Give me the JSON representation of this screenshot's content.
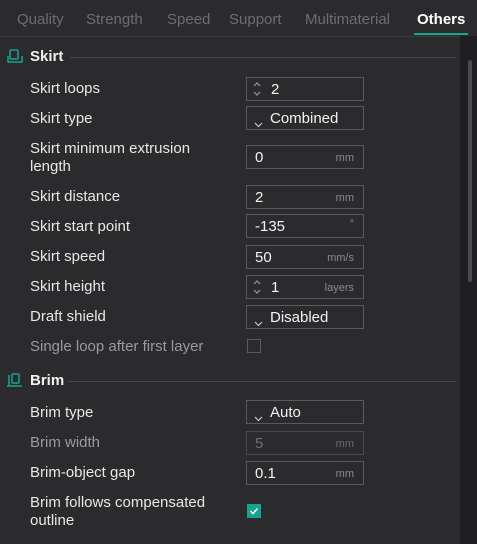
{
  "tabs": [
    {
      "label": "Quality"
    },
    {
      "label": "Strength"
    },
    {
      "label": "Speed"
    },
    {
      "label": "Support"
    },
    {
      "label": "Multimaterial"
    },
    {
      "label": "Others"
    }
  ],
  "active_tab": "Others",
  "accent_color": "#17a38d",
  "sections": {
    "skirt": {
      "title": "Skirt",
      "icon": "skirt-icon",
      "rows": {
        "loops": {
          "label": "Skirt loops",
          "value": "2"
        },
        "type": {
          "label": "Skirt type",
          "value": "Combined"
        },
        "min_extrusion": {
          "label": "Skirt minimum extrusion length",
          "value": "0",
          "unit": "mm"
        },
        "distance": {
          "label": "Skirt distance",
          "value": "2",
          "unit": "mm"
        },
        "start_point": {
          "label": "Skirt start point",
          "value": "-135",
          "unit": "°"
        },
        "speed": {
          "label": "Skirt speed",
          "value": "50",
          "unit": "mm/s"
        },
        "height": {
          "label": "Skirt height",
          "value": "1",
          "unit": "layers"
        },
        "draft_shield": {
          "label": "Draft shield",
          "value": "Disabled"
        },
        "single_loop": {
          "label": "Single loop after first layer",
          "checked": false
        }
      }
    },
    "brim": {
      "title": "Brim",
      "icon": "brim-icon",
      "rows": {
        "type": {
          "label": "Brim type",
          "value": "Auto"
        },
        "width": {
          "label": "Brim width",
          "value": "5",
          "unit": "mm"
        },
        "object_gap": {
          "label": "Brim-object gap",
          "value": "0.1",
          "unit": "mm"
        },
        "follows_outline": {
          "label": "Brim follows compensated outline",
          "checked": true
        }
      }
    }
  }
}
